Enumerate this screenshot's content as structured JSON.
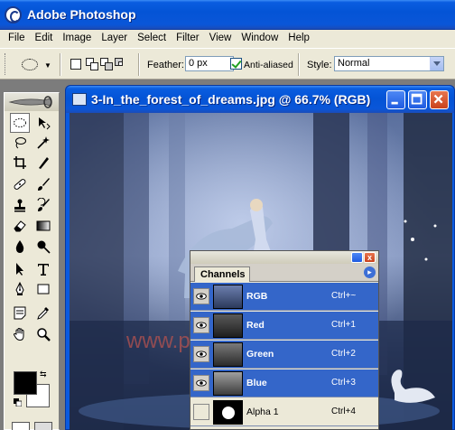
{
  "app": {
    "title": "Adobe Photoshop"
  },
  "menu": [
    "File",
    "Edit",
    "Image",
    "Layer",
    "Select",
    "Filter",
    "View",
    "Window",
    "Help"
  ],
  "options": {
    "feather_label": "Feather:",
    "feather_value": "0 px",
    "antialiased_label": "Anti-aliased",
    "antialiased_checked": true,
    "style_label": "Style:",
    "style_value": "Normal"
  },
  "document": {
    "title": "3-In_the_forest_of_dreams.jpg @ 66.7% (RGB)",
    "watermark": "www.pcjc.com"
  },
  "channels": {
    "tab": "Channels",
    "close_glyph": "x",
    "menu_glyph": "▸",
    "rows": [
      {
        "name": "RGB",
        "shortcut": "Ctrl+~",
        "selected": true,
        "visible": true
      },
      {
        "name": "Red",
        "shortcut": "Ctrl+1",
        "selected": true,
        "visible": true
      },
      {
        "name": "Green",
        "shortcut": "Ctrl+2",
        "selected": true,
        "visible": true
      },
      {
        "name": "Blue",
        "shortcut": "Ctrl+3",
        "selected": true,
        "visible": true
      },
      {
        "name": "Alpha 1",
        "shortcut": "Ctrl+4",
        "selected": false,
        "visible": false
      }
    ]
  },
  "colors": {
    "accent": "#0454d6",
    "selection": "#3466c9",
    "foreground": "#000000",
    "background": "#ffffff"
  }
}
